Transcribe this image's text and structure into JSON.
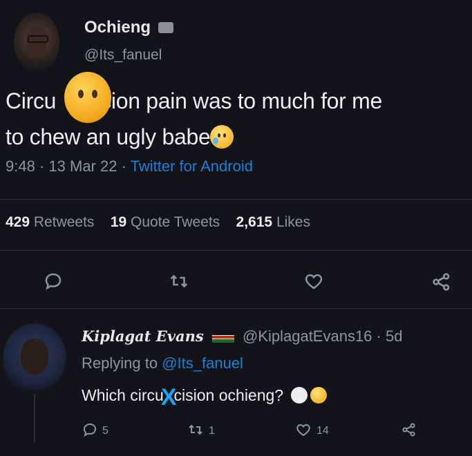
{
  "tweet": {
    "author_name": "Ochieng",
    "author_handle": "@Its_fanuel",
    "text_line1_pre": "Circu",
    "text_line1_post": "sion pain was to much for me",
    "text_line2": "to chew an ugly babe",
    "time": "9:48",
    "date": "13 Mar 22",
    "source": "Twitter for Android",
    "sep": "·"
  },
  "stats": {
    "retweets_count": "429",
    "retweets_label": "Retweets",
    "quotes_count": "19",
    "quotes_label": "Quote Tweets",
    "likes_count": "2,615",
    "likes_label": "Likes"
  },
  "icons": {
    "reply": "reply-icon",
    "retweet": "retweet-icon",
    "like": "heart-icon",
    "share": "share-icon"
  },
  "reply": {
    "author_name": "Kiplagat Evans",
    "author_handle": "@KiplagatEvans16",
    "age": "5d",
    "sep": "·",
    "replying_label": "Replying to",
    "replying_to": "@Its_fanuel",
    "text_pre": "Which circu",
    "mark": "X",
    "text_post": "cision ochieng?",
    "reply_count": "5",
    "retweet_count": "1",
    "like_count": "14"
  },
  "colors": {
    "background": "#12141a",
    "link": "#1d7fd8",
    "muted": "#8b96a3",
    "overlay_x": "#1da1f2"
  }
}
